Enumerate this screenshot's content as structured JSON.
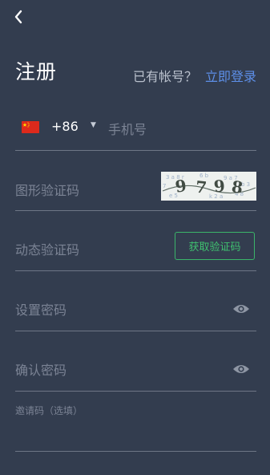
{
  "header": {
    "title": "注册",
    "has_account_text": "已有帐号？",
    "login_link": "立即登录"
  },
  "phone": {
    "country_flag": "china-flag-icon",
    "country_code": "+86",
    "placeholder": "手机号"
  },
  "image_captcha": {
    "placeholder": "图形验证码",
    "captcha_text": "9798"
  },
  "sms_captcha": {
    "placeholder": "动态验证码",
    "button_label": "获取验证码"
  },
  "password": {
    "placeholder": "设置密码"
  },
  "confirm_password": {
    "placeholder": "确认密码"
  },
  "invite_code": {
    "label": "邀请码（选填）"
  },
  "colors": {
    "background": "#333d4f",
    "accent_link": "#5d8fe8",
    "button_green": "#3fc06f",
    "divider": "#6e7686"
  }
}
